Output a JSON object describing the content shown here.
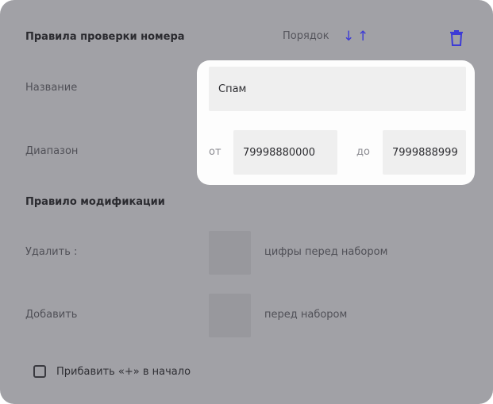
{
  "header": {
    "title": "Правила проверки номера",
    "order_label": "Порядок",
    "icons": {
      "sort_down": "↓",
      "sort_up": "↑",
      "delete": "trash-icon"
    }
  },
  "name_row": {
    "label": "Название",
    "value": "Спам"
  },
  "range_row": {
    "label": "Диапазон",
    "from_label": "от",
    "from_value": "79998880000",
    "to_label": "до",
    "to_value": "7999888999"
  },
  "modification": {
    "title": "Правило модификации",
    "delete_label": "Удалить :",
    "delete_hint": "цифры перед набором",
    "add_label": "Добавить",
    "add_hint": "перед набором"
  },
  "prefix_checkbox": {
    "label": "Прибавить «+» в начало"
  },
  "colors": {
    "accent": "#3d3bd6",
    "overlay": "#a1a1a6",
    "highlight": "#fdfdfd"
  }
}
